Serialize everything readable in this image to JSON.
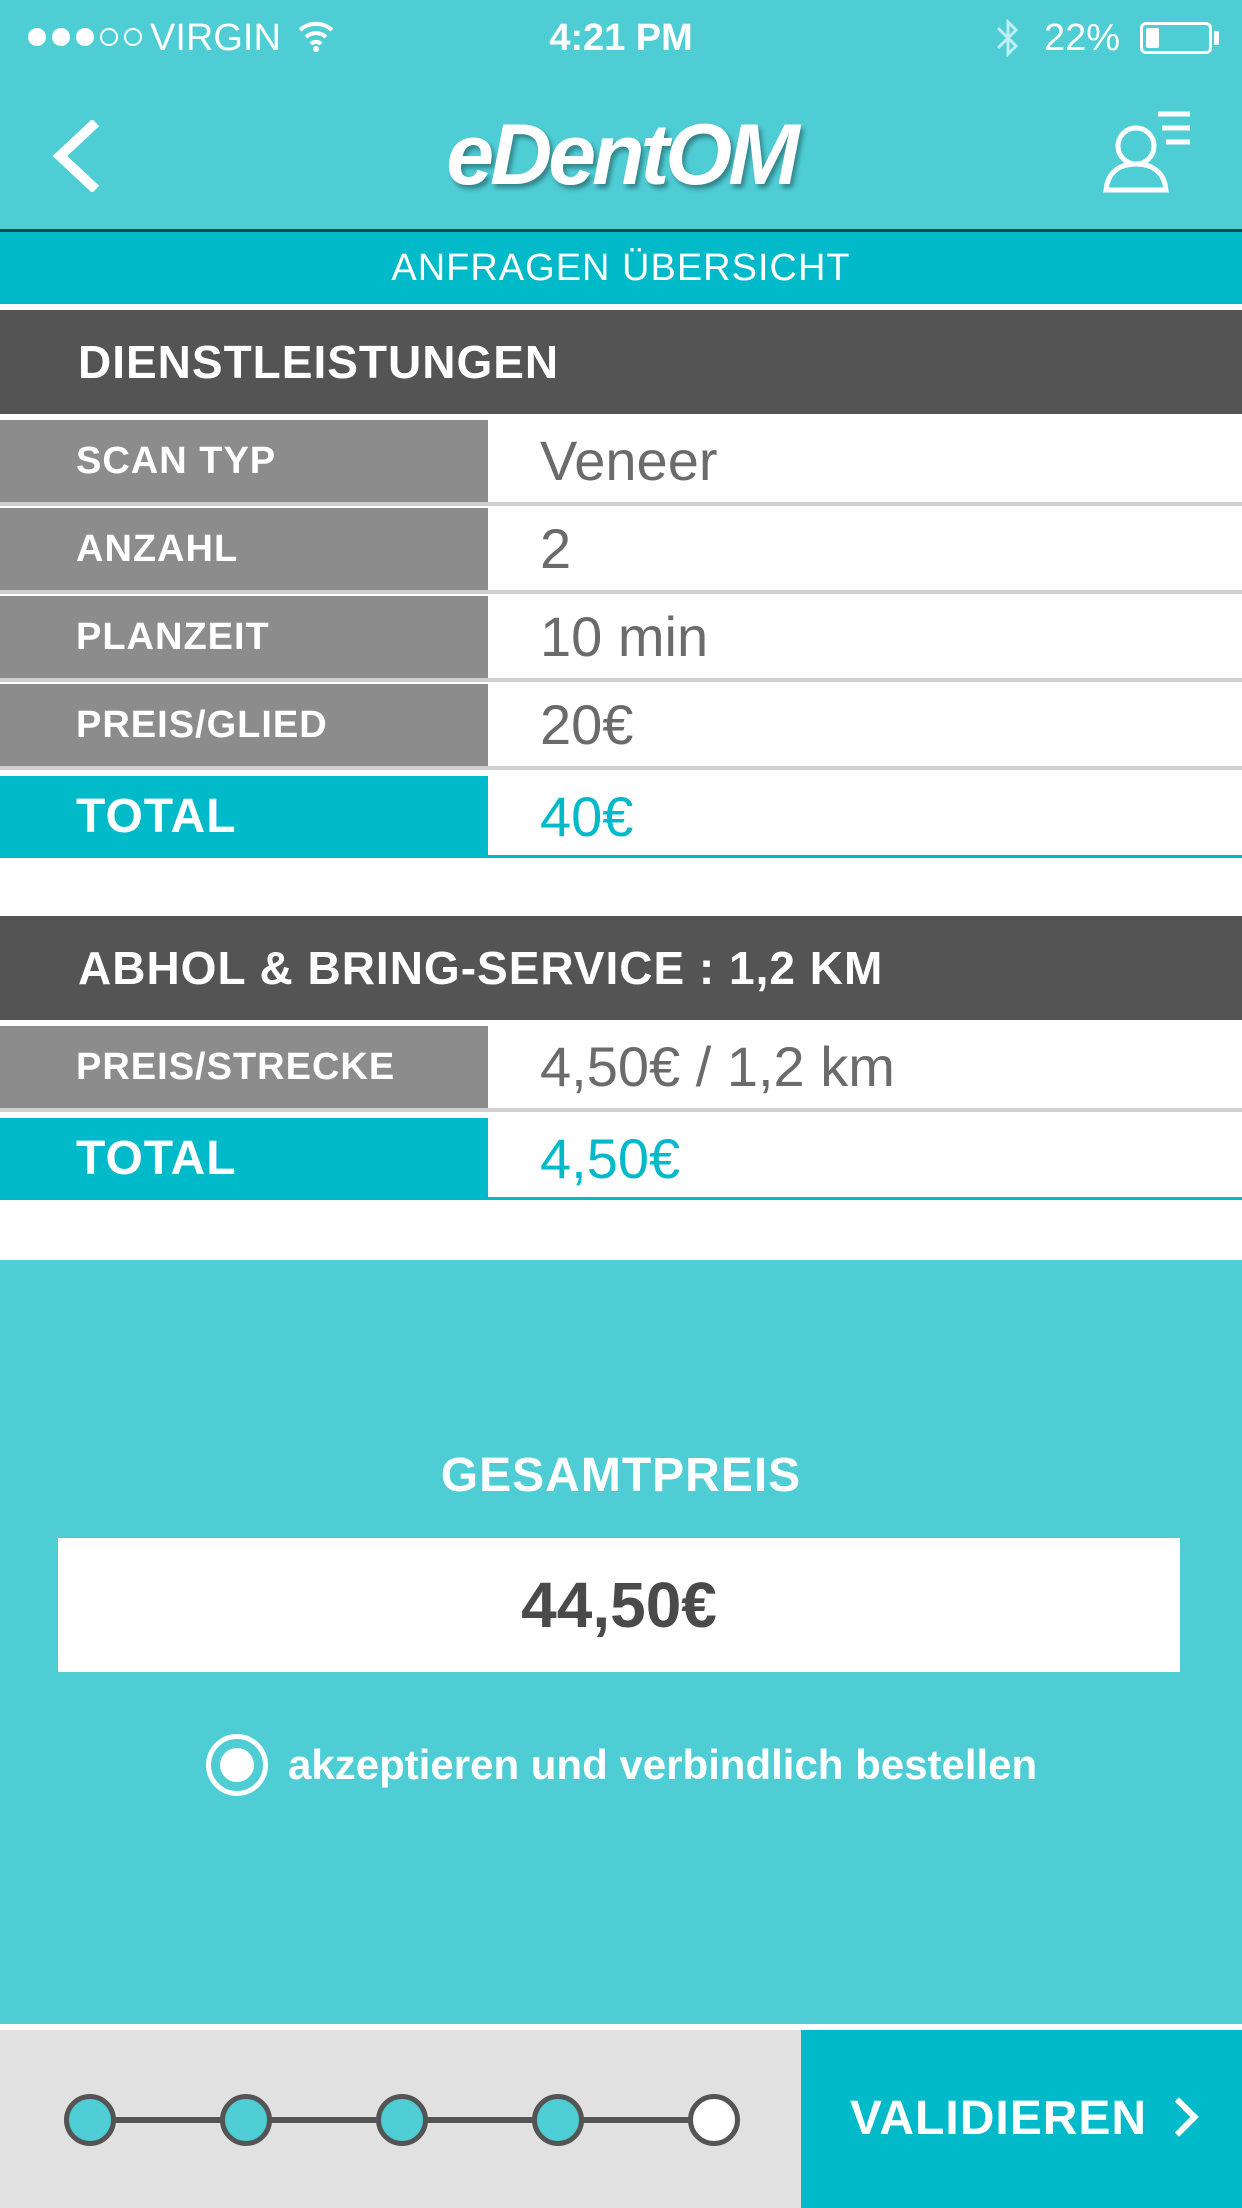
{
  "status_bar": {
    "carrier": "VIRGIN",
    "time": "4:21 PM",
    "battery": "22%",
    "signal_dots": {
      "full": 3,
      "empty": 2
    },
    "battery_level": 0.22
  },
  "nav": {
    "logo": "eDentOM",
    "back_icon": "chevron-left-icon",
    "profile_icon": "user-menu-icon"
  },
  "subheader": {
    "title": "ANFRAGEN ÜBERSICHT"
  },
  "services": {
    "header": "DIENSTLEISTUNGEN",
    "rows": [
      {
        "label": "SCAN TYP",
        "value": "Veneer"
      },
      {
        "label": "ANZAHL",
        "value": "2"
      },
      {
        "label": "PLANZEIT",
        "value": "10 min"
      },
      {
        "label": "PREIS/GLIED",
        "value": "20€"
      }
    ],
    "total": {
      "label": "TOTAL",
      "value": "40€"
    }
  },
  "pickup": {
    "header": "ABHOL & BRING-SERVICE : 1,2 KM",
    "rows": [
      {
        "label": "PREIS/STRECKE",
        "value": "4,50€ / 1,2 km"
      }
    ],
    "total": {
      "label": "TOTAL",
      "value": "4,50€"
    }
  },
  "summary": {
    "label": "GESAMTPREIS",
    "price": "44,50€",
    "accept_text": "akzeptieren und verbindlich bestellen",
    "accept_selected": true
  },
  "footer": {
    "steps_total": 5,
    "current_step": 5,
    "validate_label": "VALIDIEREN"
  },
  "colors": {
    "accent": "#4ecdd5",
    "accent_dark": "#00b9c9",
    "header_gray": "#545454",
    "label_gray": "#8c8c8c",
    "value_text": "#6b6b6b"
  }
}
